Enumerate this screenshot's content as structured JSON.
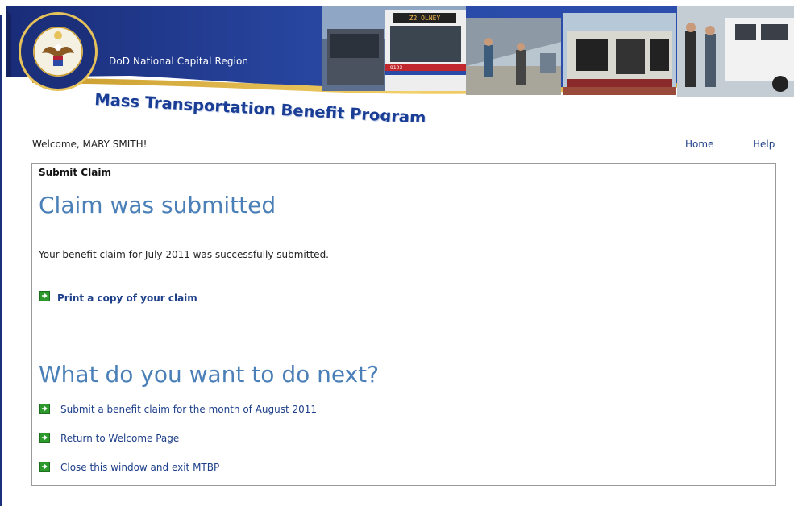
{
  "banner": {
    "region": "DoD National Capital Region",
    "program": "Mass Transportation Benefit Program",
    "bus_route": "Z2 OLNEY",
    "bus_number": "9103"
  },
  "nav": {
    "welcome": "Welcome, MARY SMITH!",
    "home": "Home",
    "help": "Help"
  },
  "panel": {
    "title": "Submit Claim",
    "heading": "Claim was submitted",
    "message": "Your benefit claim for July 2011 was successfully submitted.",
    "print_link": "Print a copy of your claim",
    "next_heading": "What do you want to do next?",
    "next_actions": [
      "Submit a benefit claim for the month of August 2011",
      "Return to Welcome Page",
      "Close this window and exit MTBP"
    ]
  },
  "colors": {
    "banner_blue": "#1b2f7a",
    "heading_blue": "#4a7fb7",
    "link_blue": "#1e3f8a",
    "arrow_green": "#2e9a2e"
  }
}
